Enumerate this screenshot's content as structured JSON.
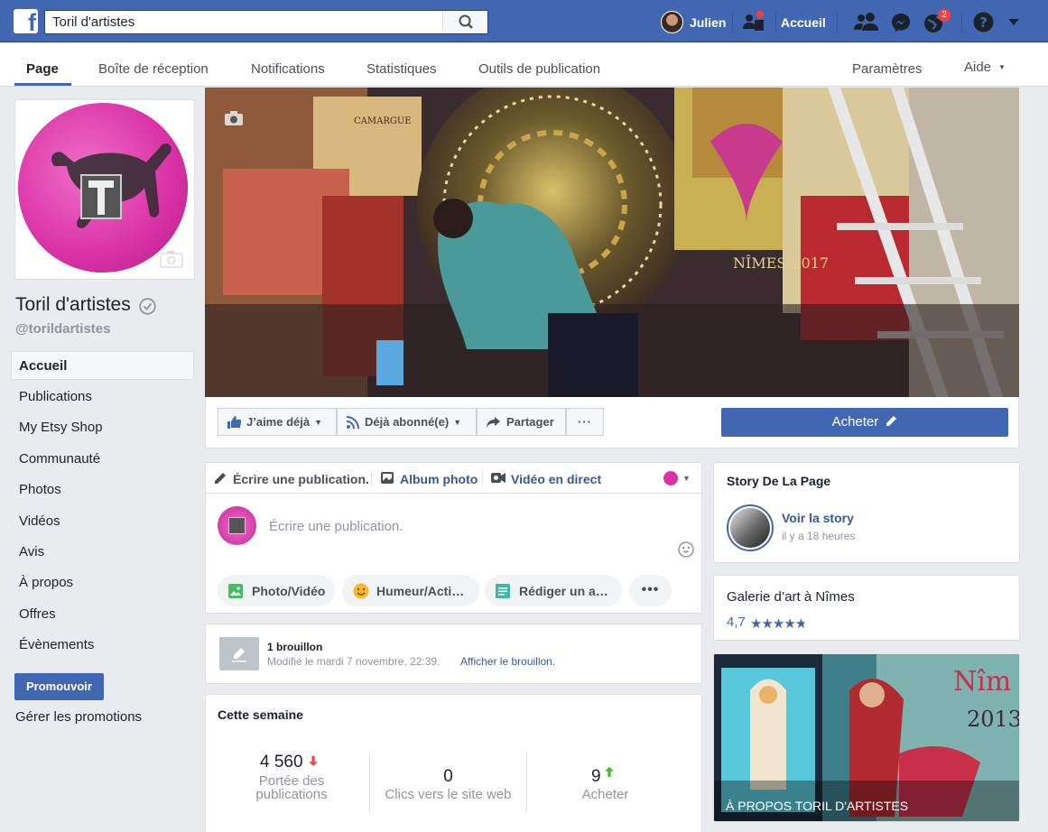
{
  "topbar": {
    "search_value": "Toril d'artistes",
    "user_name": "Julien",
    "home_label": "Accueil",
    "notif_badge": "2"
  },
  "page_nav": {
    "tabs": [
      "Page",
      "Boîte de réception",
      "Notifications",
      "Statistiques",
      "Outils de publication"
    ],
    "settings": "Paramètres",
    "help": "Aide"
  },
  "page": {
    "name": "Toril d'artistes",
    "handle": "@torildartistes"
  },
  "sidebar": {
    "items": [
      "Accueil",
      "Publications",
      "My Etsy Shop",
      "Communauté",
      "Photos",
      "Vidéos",
      "Avis",
      "À propos",
      "Offres",
      "Évènements"
    ],
    "promote_button": "Promouvoir",
    "manage_promotions": "Gérer les promotions"
  },
  "actions": {
    "like": "J’aime déjà",
    "follow": "Déjà abonné(e)",
    "share": "Partager",
    "more": "···",
    "buy": "Acheter"
  },
  "composer": {
    "tabs": [
      "Écrire une publication.",
      "Album photo",
      "Vidéo en direct"
    ],
    "placeholder": "Écrire une publication.",
    "buttons": [
      "Photo/Vidéo",
      "Humeur/Acti…",
      "Rédiger un a…"
    ]
  },
  "draft": {
    "title": "1 brouillon",
    "modified": "Modifié le mardi 7 novembre, 22:39.",
    "link": "Afficher le brouillon."
  },
  "week": {
    "title": "Cette semaine",
    "stats": [
      {
        "value": "4 560",
        "label": "Portée des publications",
        "trend": "down"
      },
      {
        "value": "0",
        "label": "Clics vers le site web",
        "trend": "none"
      },
      {
        "value": "9",
        "label": "Acheter",
        "trend": "up"
      }
    ]
  },
  "story": {
    "title": "Story De La Page",
    "link": "Voir la story",
    "time": "il y a 18 heures"
  },
  "category": {
    "label": "Galerie d’art à Nîmes",
    "rating": "4,7",
    "stars": 4.7
  },
  "about_image": {
    "caption": "À PROPOS TORIL D'ARTISTES"
  },
  "colors": {
    "brand": "#4267b2",
    "badge": "#fa3e3e"
  }
}
